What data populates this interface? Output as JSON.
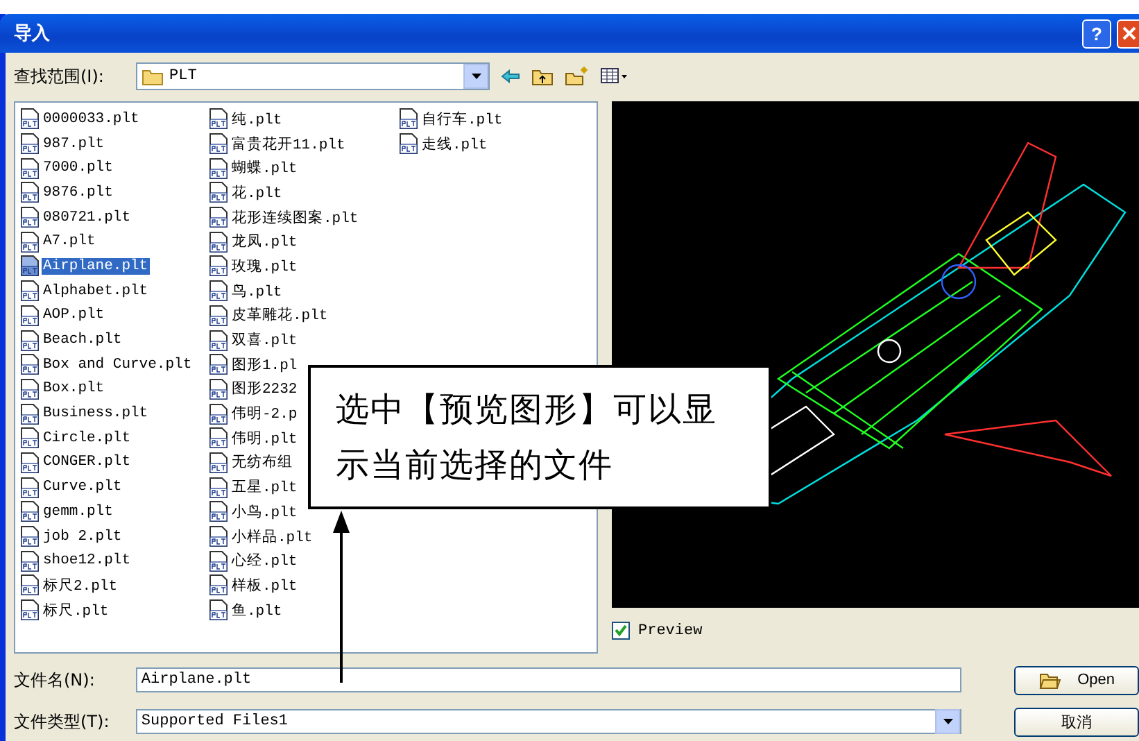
{
  "window": {
    "title": "导入",
    "help_button": "?"
  },
  "look_in": {
    "label": "查找范围(I):",
    "value": "PLT"
  },
  "file_columns": [
    [
      {
        "name": "0000033.plt",
        "selected": false
      },
      {
        "name": "987.plt",
        "selected": false
      },
      {
        "name": "7000.plt",
        "selected": false
      },
      {
        "name": "9876.plt",
        "selected": false
      },
      {
        "name": "080721.plt",
        "selected": false
      },
      {
        "name": "A7.plt",
        "selected": false
      },
      {
        "name": "Airplane.plt",
        "selected": true
      },
      {
        "name": "Alphabet.plt",
        "selected": false
      },
      {
        "name": "AOP.plt",
        "selected": false
      },
      {
        "name": "Beach.plt",
        "selected": false
      },
      {
        "name": "Box and Curve.plt",
        "selected": false
      },
      {
        "name": "Box.plt",
        "selected": false
      },
      {
        "name": "Business.plt",
        "selected": false
      },
      {
        "name": "Circle.plt",
        "selected": false
      },
      {
        "name": "CONGER.plt",
        "selected": false
      },
      {
        "name": "Curve.plt",
        "selected": false
      },
      {
        "name": "gemm.plt",
        "selected": false
      },
      {
        "name": "job 2.plt",
        "selected": false
      },
      {
        "name": "shoe12.plt",
        "selected": false
      },
      {
        "name": "标尺2.plt",
        "selected": false
      },
      {
        "name": "标尺.plt",
        "selected": false
      }
    ],
    [
      {
        "name": "纯.plt",
        "selected": false
      },
      {
        "name": "富贵花开11.plt",
        "selected": false
      },
      {
        "name": "蝴蝶.plt",
        "selected": false
      },
      {
        "name": "花.plt",
        "selected": false
      },
      {
        "name": "花形连续图案.plt",
        "selected": false
      },
      {
        "name": "龙凤.plt",
        "selected": false
      },
      {
        "name": "玫瑰.plt",
        "selected": false
      },
      {
        "name": "鸟.plt",
        "selected": false
      },
      {
        "name": "皮革雕花.plt",
        "selected": false
      },
      {
        "name": "双喜.plt",
        "selected": false
      },
      {
        "name": "图形1.pl",
        "selected": false
      },
      {
        "name": "图形2232",
        "selected": false
      },
      {
        "name": "伟明-2.p",
        "selected": false
      },
      {
        "name": "伟明.plt",
        "selected": false
      },
      {
        "name": "无纺布组",
        "selected": false
      },
      {
        "name": "五星.plt",
        "selected": false
      },
      {
        "name": "小鸟.plt",
        "selected": false
      },
      {
        "name": "小样品.plt",
        "selected": false
      },
      {
        "name": "心经.plt",
        "selected": false
      },
      {
        "name": "样板.plt",
        "selected": false
      },
      {
        "name": "鱼.plt",
        "selected": false
      }
    ],
    [
      {
        "name": "自行车.plt",
        "selected": false
      },
      {
        "name": "走线.plt",
        "selected": false
      }
    ]
  ],
  "preview": {
    "label": "Preview",
    "checked": true
  },
  "file_name": {
    "label": "文件名(N):",
    "value": "Airplane.plt"
  },
  "file_type": {
    "label": "文件类型(T):",
    "value": "Supported Files1"
  },
  "buttons": {
    "open": "Open",
    "cancel": "取消"
  },
  "callout": {
    "text": "选中【预览图形】可以显示当前选择的文件"
  }
}
